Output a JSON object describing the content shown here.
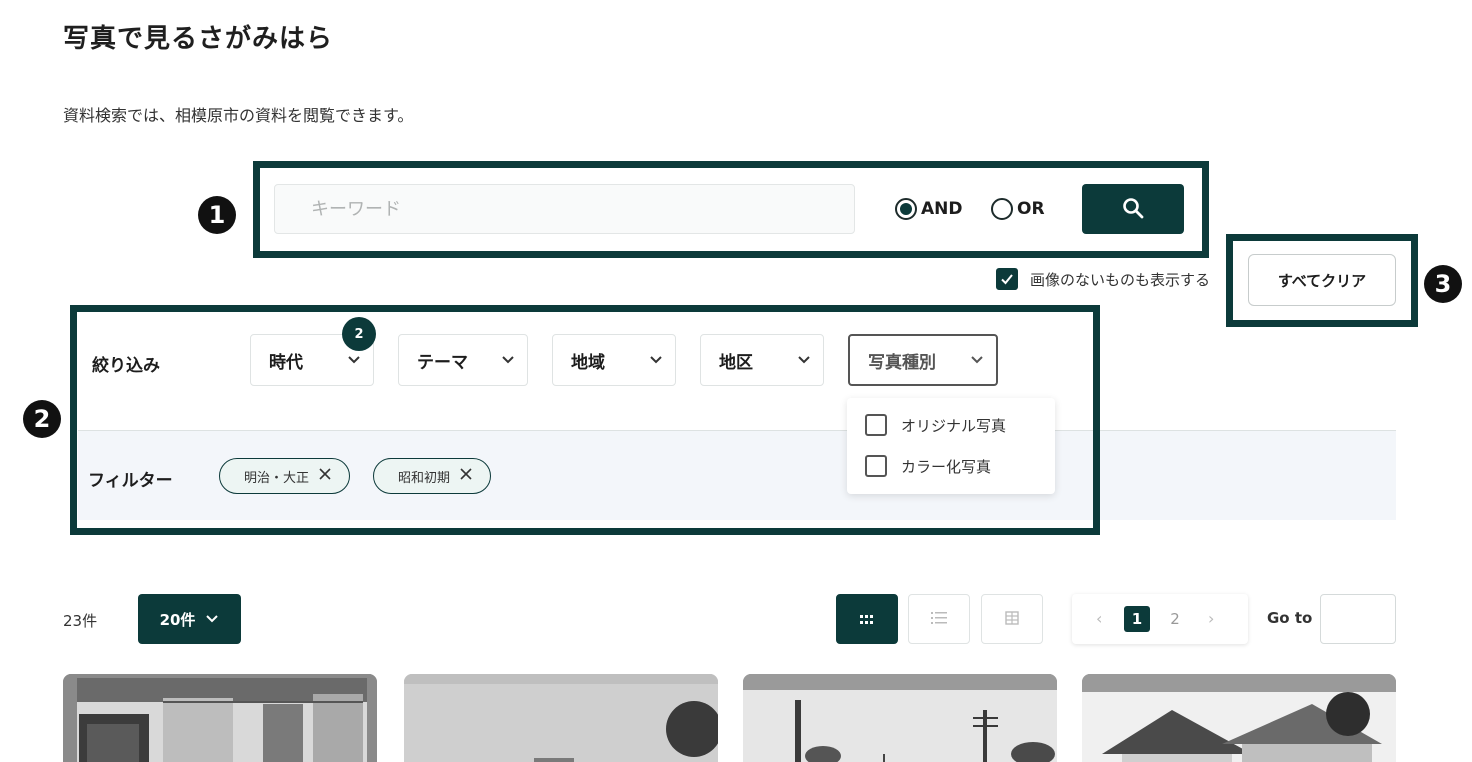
{
  "page": {
    "title": "写真で見るさがみはら",
    "description": "資料検索では、相模原市の資料を閲覧できます。"
  },
  "annotations": {
    "one": "1",
    "two": "2",
    "three": "3"
  },
  "search": {
    "placeholder": "キーワード",
    "mode_and": "AND",
    "mode_or": "OR",
    "selected_mode": "AND",
    "icon": "search-icon"
  },
  "options": {
    "show_no_image_label": "画像のないものも表示する",
    "show_no_image_checked": true,
    "clear_all_label": "すべてクリア"
  },
  "filters": {
    "narrow_label": "絞り込み",
    "dropdowns": [
      {
        "label": "時代",
        "badge": "2"
      },
      {
        "label": "テーマ"
      },
      {
        "label": "地域"
      },
      {
        "label": "地区"
      },
      {
        "label": "写真種別",
        "open": true
      }
    ],
    "photo_type_options": [
      "オリジナル写真",
      "カラー化写真"
    ],
    "filter_label": "フィルター",
    "chips": [
      "明治・大正",
      "昭和初期"
    ]
  },
  "results": {
    "count": "23件",
    "per_page": "20件",
    "pagination": {
      "prev": "‹",
      "pages": [
        "1",
        "2"
      ],
      "current": "1",
      "next": "›"
    },
    "goto_label": "Go to"
  },
  "colors": {
    "accent": "#0c3a3a",
    "filter_band": "#f3f6fa",
    "chip_bg": "#edf5f3"
  }
}
